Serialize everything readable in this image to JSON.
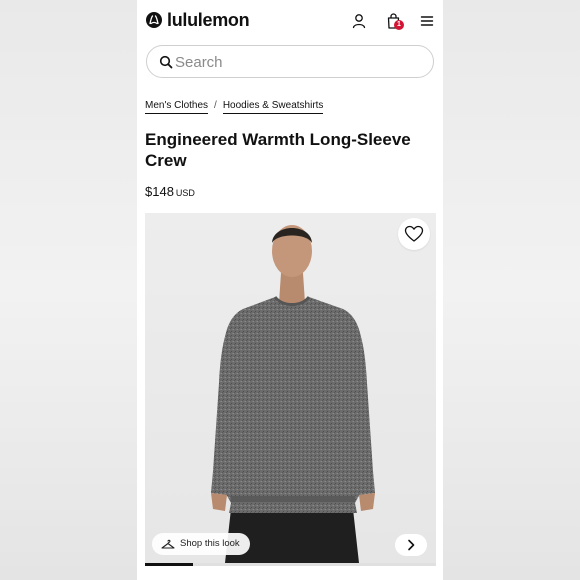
{
  "header": {
    "brand": "lululemon",
    "bag_count": "1"
  },
  "search": {
    "placeholder": "Search"
  },
  "breadcrumbs": [
    {
      "label": "Men's Clothes"
    },
    {
      "label": "Hoodies & Sweatshirts"
    }
  ],
  "breadcrumb_separator": "/",
  "product": {
    "title": "Engineered Warmth Long-Sleeve Crew",
    "price": "$148",
    "currency": "USD"
  },
  "gallery": {
    "shop_this_look": "Shop this look",
    "progress_fraction": 0.166
  },
  "colors": {
    "badge": "#d31334",
    "sweater": "#6b6b6b",
    "pants": "#1f1f1f"
  },
  "icons": [
    "lululemon-logo-icon",
    "account-icon",
    "shopping-bag-icon",
    "menu-icon",
    "search-icon",
    "heart-icon",
    "hanger-icon",
    "chevron-right-icon"
  ]
}
